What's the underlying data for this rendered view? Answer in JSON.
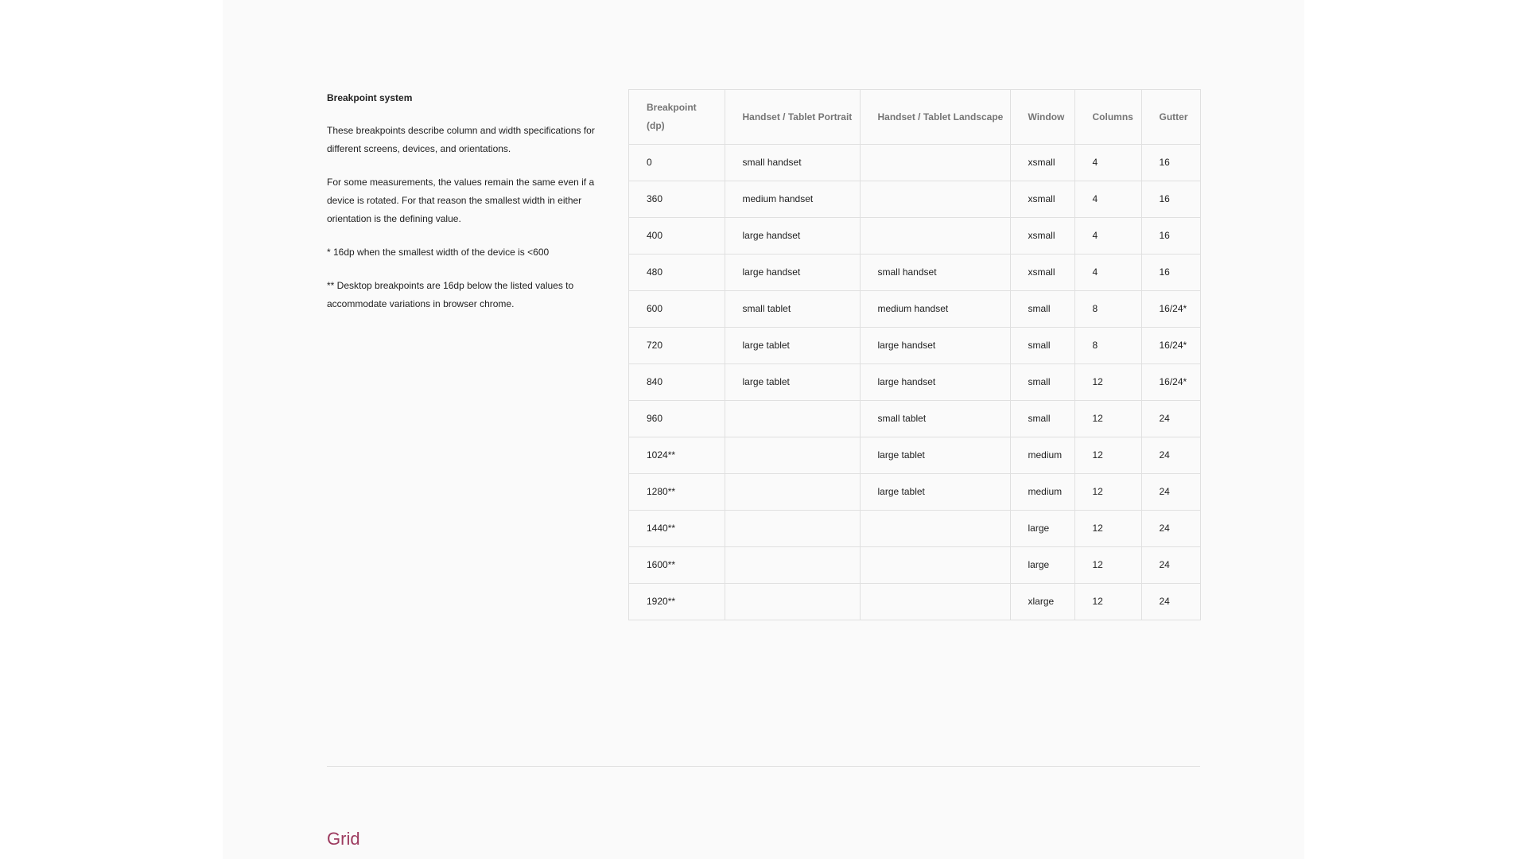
{
  "intro": {
    "heading": "Breakpoint system",
    "paragraphs": [
      "These breakpoints describe column and width specifications for different screens, devices, and orientations.",
      "For some measurements, the values remain the same even if a device is rotated. For that reason the smallest width in either orientation is the defining value.",
      "* 16dp when the smallest width of the device is <600",
      "** Desktop breakpoints are 16dp below the listed values to accommodate variations in browser chrome."
    ]
  },
  "table": {
    "headers": [
      "Breakpoint (dp)",
      "Handset / Tablet Portrait",
      "Handset / Tablet Landscape",
      "Window",
      "Columns",
      "Gutter"
    ],
    "rows": [
      [
        "0",
        "small handset",
        "",
        "xsmall",
        "4",
        "16"
      ],
      [
        "360",
        "medium handset",
        "",
        "xsmall",
        "4",
        "16"
      ],
      [
        "400",
        "large handset",
        "",
        "xsmall",
        "4",
        "16"
      ],
      [
        "480",
        "large handset",
        "small handset",
        "xsmall",
        "4",
        "16"
      ],
      [
        "600",
        "small tablet",
        "medium handset",
        "small",
        "8",
        "16/24*"
      ],
      [
        "720",
        "large tablet",
        "large handset",
        "small",
        "8",
        "16/24*"
      ],
      [
        "840",
        "large tablet",
        "large handset",
        "small",
        "12",
        "16/24*"
      ],
      [
        "960",
        "",
        "small tablet",
        "small",
        "12",
        "24"
      ],
      [
        "1024**",
        "",
        "large tablet",
        "medium",
        "12",
        "24"
      ],
      [
        "1280**",
        "",
        "large tablet",
        "medium",
        "12",
        "24"
      ],
      [
        "1440**",
        "",
        "",
        "large",
        "12",
        "24"
      ],
      [
        "1600**",
        "",
        "",
        "large",
        "12",
        "24"
      ],
      [
        "1920**",
        "",
        "",
        "xlarge",
        "12",
        "24"
      ]
    ]
  },
  "next_section": {
    "title": "Grid"
  },
  "colors": {
    "accent": "#9c3a5e",
    "panel_bg": "#fafafa",
    "border": "#e0e0e0",
    "header_text": "#757575"
  }
}
